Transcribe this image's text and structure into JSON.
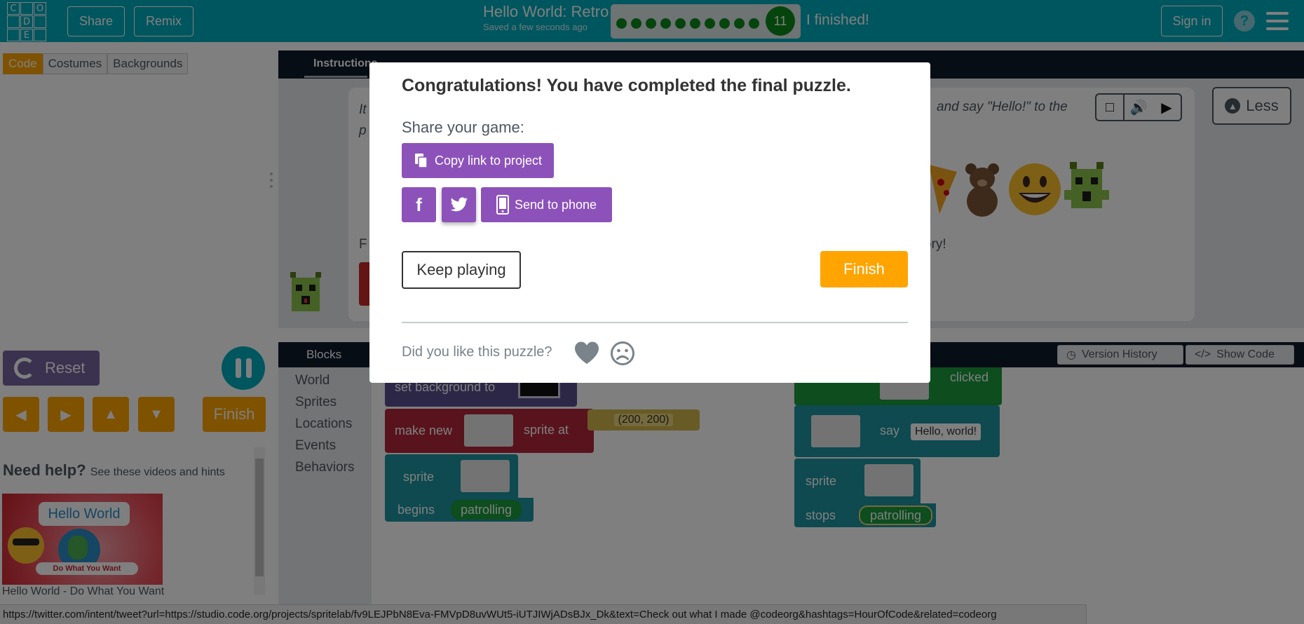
{
  "header": {
    "logo_letters": [
      "C",
      "O",
      "D",
      "E"
    ],
    "share_label": "Share",
    "remix_label": "Remix",
    "project_title": "Hello World: Retro",
    "saved_text": "Saved a few seconds ago",
    "progress_count": "11",
    "finished_text": "I finished!",
    "signin_label": "Sign in",
    "help_symbol": "?",
    "accent_color": "#00adbc"
  },
  "left_panel": {
    "tabs": [
      {
        "label": "Code",
        "active": true
      },
      {
        "label": "Costumes",
        "active": false
      },
      {
        "label": "Backgrounds",
        "active": false
      }
    ],
    "reset_label": "Reset",
    "finish_label": "Finish",
    "help_heading": "Need help?",
    "help_sub": "See these videos and hints",
    "video": {
      "bubble_text": "Hello World",
      "banner_text": "Do What You Want",
      "title": "Hello World - Do What You Want"
    }
  },
  "instructions": {
    "tab_label": "Instructions",
    "text_left_line1": "It",
    "text_left_line2": "p",
    "text_right": "and say \"Hello!\" to the",
    "line2_left": "F",
    "line2_right": "ory!",
    "less_label": "Less"
  },
  "workspace": {
    "blocks_tab": "Blocks",
    "version_history_label": "Version History",
    "show_code_label": "Show Code",
    "toolbox_categories": [
      "World",
      "Sprites",
      "Locations",
      "Events",
      "Behaviors"
    ],
    "blocks": {
      "set_background": "set background to",
      "make_new": "make new",
      "sprite_at": "sprite at",
      "coordinates": "(200, 200)",
      "sprite": "sprite",
      "begins": "begins",
      "patrolling": "patrolling",
      "clicked": "clicked",
      "say": "say",
      "hello_world": "Hello, world!",
      "stops": "stops"
    }
  },
  "status_bar_url": "https://twitter.com/intent/tweet?url=https://studio.code.org/projects/spritelab/fv9LEJPbN8Eva-FMVpD8uvWUt5-iUTJIWjADsBJx_Dk&text=Check out what I made @codeorg&hashtags=HourOfCode&related=codeorg",
  "modal": {
    "title": "Congratulations! You have completed the final puzzle.",
    "share_label": "Share your game:",
    "copy_link_label": "Copy link to project",
    "send_phone_label": "Send to phone",
    "keep_playing_label": "Keep playing",
    "finish_label": "Finish",
    "like_question": "Did you like this puzzle?",
    "purple_color": "#8c52ba",
    "orange_color": "#ffa400"
  }
}
